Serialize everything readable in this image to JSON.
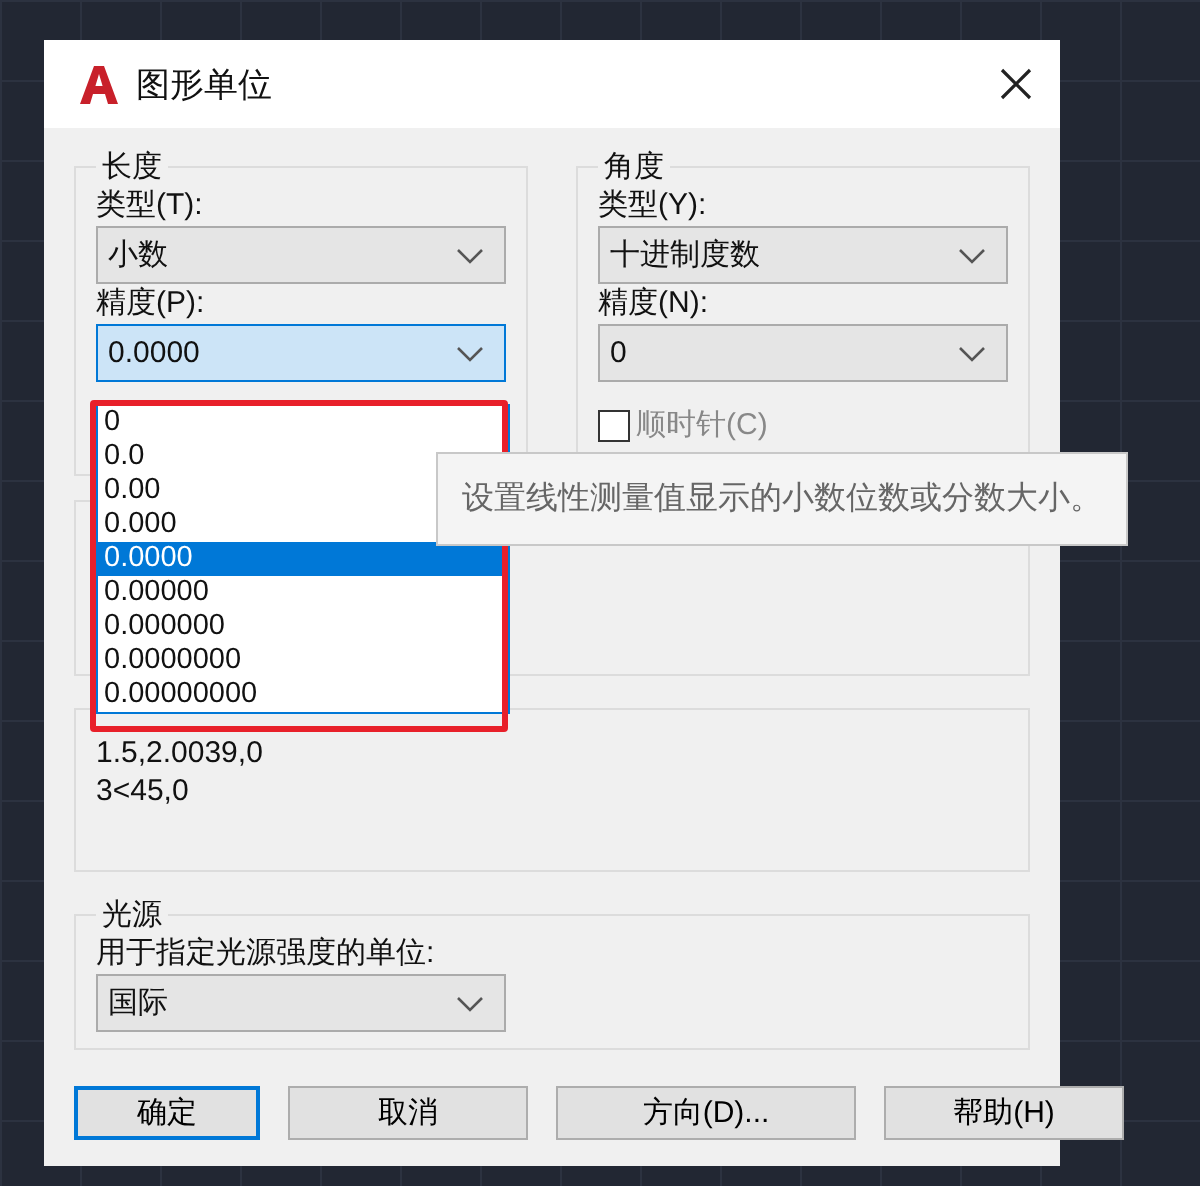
{
  "window": {
    "title": "图形单位"
  },
  "length": {
    "title": "长度",
    "type_label": "类型(T):",
    "type_value": "小数",
    "precision_label": "精度(P):",
    "precision_value": "0.0000",
    "precision_open": true,
    "precision_options": [
      {
        "label": "0",
        "selected": false
      },
      {
        "label": "0.0",
        "selected": false
      },
      {
        "label": "0.00",
        "selected": false
      },
      {
        "label": "0.000",
        "selected": false
      },
      {
        "label": "0.0000",
        "selected": true
      },
      {
        "label": "0.00000",
        "selected": false
      },
      {
        "label": "0.000000",
        "selected": false
      },
      {
        "label": "0.0000000",
        "selected": false
      },
      {
        "label": "0.00000000",
        "selected": false
      }
    ]
  },
  "angle": {
    "title": "角度",
    "type_label": "类型(Y):",
    "type_value": "十进制度数",
    "precision_label": "精度(N):",
    "precision_value": "0",
    "clockwise": {
      "label": "顺时针(C)",
      "checked": false
    }
  },
  "tooltip": "设置线性测量值显示的小数位数或分数大小。",
  "sample_output": {
    "lines": [
      "1.5,2.0039,0",
      "3<45,0"
    ]
  },
  "lighting": {
    "title": "光源",
    "label": "用于指定光源强度的单位:",
    "value": "国际"
  },
  "buttons": [
    {
      "label": "确定",
      "default": true
    },
    {
      "label": "取消",
      "default": false
    },
    {
      "label": "方向(D)...",
      "default": false
    },
    {
      "label": "帮助(H)",
      "default": false
    }
  ]
}
